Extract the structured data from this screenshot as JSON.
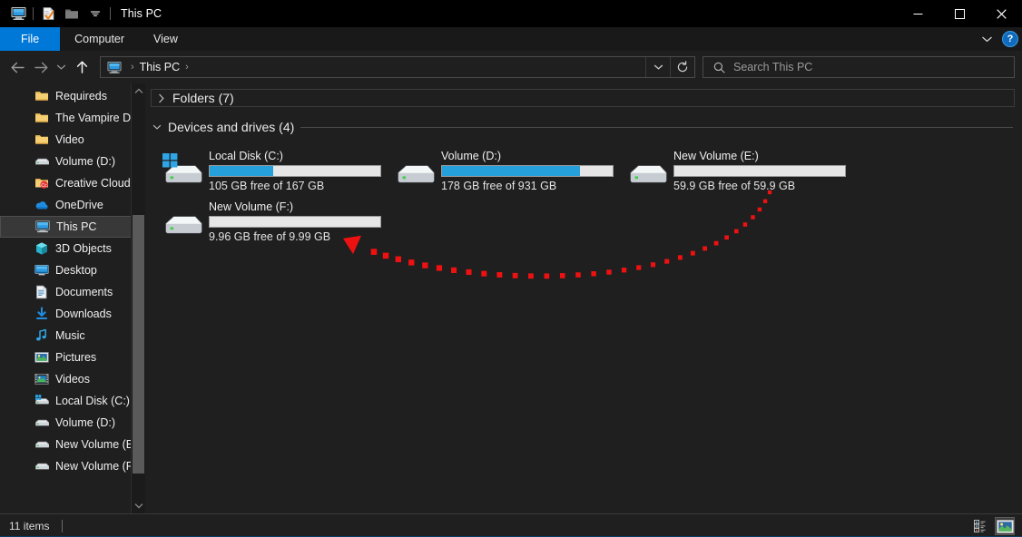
{
  "window": {
    "title": "This PC",
    "quick_access": [
      {
        "name": "this-pc-icon",
        "label": "This PC"
      },
      {
        "name": "properties-icon",
        "label": "Properties"
      },
      {
        "name": "new-folder-icon",
        "label": "New folder"
      },
      {
        "name": "customize-quick-access-chevron",
        "label": "Customize Quick Access Toolbar"
      }
    ],
    "controls": {
      "minimize": "—",
      "maximize": "□",
      "close": "✕"
    }
  },
  "ribbon": {
    "tabs": [
      {
        "label": "File",
        "active": true
      },
      {
        "label": "Computer",
        "active": false
      },
      {
        "label": "View",
        "active": false
      }
    ],
    "collapse_label": "∨",
    "help_label": "?"
  },
  "address": {
    "back_label": "←",
    "forward_label": "→",
    "recent_label": "∨",
    "up_label": "↑",
    "crumbs": [
      "This PC"
    ],
    "separator": "›",
    "dropdown_label": "∨",
    "refresh_label": "↻"
  },
  "search": {
    "placeholder": "Search This PC",
    "icon": "search-icon"
  },
  "sidebar": {
    "items": [
      {
        "label": "Requireds",
        "icon": "folder-icon",
        "indent": 2,
        "selected": false
      },
      {
        "label": "The Vampire Dia",
        "icon": "folder-icon",
        "indent": 2,
        "selected": false
      },
      {
        "label": "Video",
        "icon": "folder-icon",
        "indent": 2,
        "selected": false
      },
      {
        "label": "Volume (D:)",
        "icon": "drive-icon",
        "indent": 2,
        "selected": false
      },
      {
        "label": "Creative Cloud Fil",
        "icon": "creative-cloud-icon",
        "indent": 1,
        "selected": false
      },
      {
        "label": "OneDrive",
        "icon": "onedrive-icon",
        "indent": 1,
        "selected": false
      },
      {
        "label": "This PC",
        "icon": "this-pc-icon",
        "indent": 1,
        "selected": true
      },
      {
        "label": "3D Objects",
        "icon": "3d-objects-icon",
        "indent": 2,
        "selected": false
      },
      {
        "label": "Desktop",
        "icon": "desktop-icon",
        "indent": 2,
        "selected": false
      },
      {
        "label": "Documents",
        "icon": "documents-icon",
        "indent": 2,
        "selected": false
      },
      {
        "label": "Downloads",
        "icon": "downloads-icon",
        "indent": 2,
        "selected": false
      },
      {
        "label": "Music",
        "icon": "music-icon",
        "indent": 2,
        "selected": false
      },
      {
        "label": "Pictures",
        "icon": "pictures-icon",
        "indent": 2,
        "selected": false
      },
      {
        "label": "Videos",
        "icon": "videos-icon",
        "indent": 2,
        "selected": false
      },
      {
        "label": "Local Disk (C:)",
        "icon": "windows-drive-icon",
        "indent": 2,
        "selected": false
      },
      {
        "label": "Volume (D:)",
        "icon": "drive-icon",
        "indent": 2,
        "selected": false
      },
      {
        "label": "New Volume (E:)",
        "icon": "drive-icon",
        "indent": 2,
        "selected": false
      },
      {
        "label": "New Volume (F:)",
        "icon": "drive-icon",
        "indent": 2,
        "selected": false
      }
    ],
    "scroll_up_label": "∧",
    "scroll_down_label": "∨"
  },
  "content": {
    "groups": [
      {
        "title": "Folders (7)",
        "expanded": false,
        "chevron": "›"
      },
      {
        "title": "Devices and drives (4)",
        "expanded": true,
        "chevron": "∨"
      }
    ],
    "drives": [
      {
        "name": "Local Disk (C:)",
        "free_text": "105 GB free of 167 GB",
        "used_percent": 37,
        "icon": "windows-drive-icon",
        "bar_color": "#26a0da"
      },
      {
        "name": "Volume (D:)",
        "free_text": "178 GB free of 931 GB",
        "used_percent": 81,
        "icon": "drive-icon",
        "bar_color": "#26a0da"
      },
      {
        "name": "New Volume (E:)",
        "free_text": "59.9 GB free of 59.9 GB",
        "used_percent": 0,
        "icon": "drive-icon",
        "bar_color": "#26a0da"
      },
      {
        "name": "New Volume (F:)",
        "free_text": "9.96 GB free of 9.99 GB",
        "used_percent": 0,
        "icon": "drive-icon",
        "bar_color": "#26a0da"
      }
    ]
  },
  "annotation": {
    "type": "curved-dotted-arrow",
    "color": "#ee1111",
    "points_to": "New Volume (F:)"
  },
  "statusbar": {
    "item_count": "11 items",
    "views": [
      {
        "name": "details-view-button",
        "selected": false
      },
      {
        "name": "large-icons-view-button",
        "selected": true
      }
    ]
  }
}
